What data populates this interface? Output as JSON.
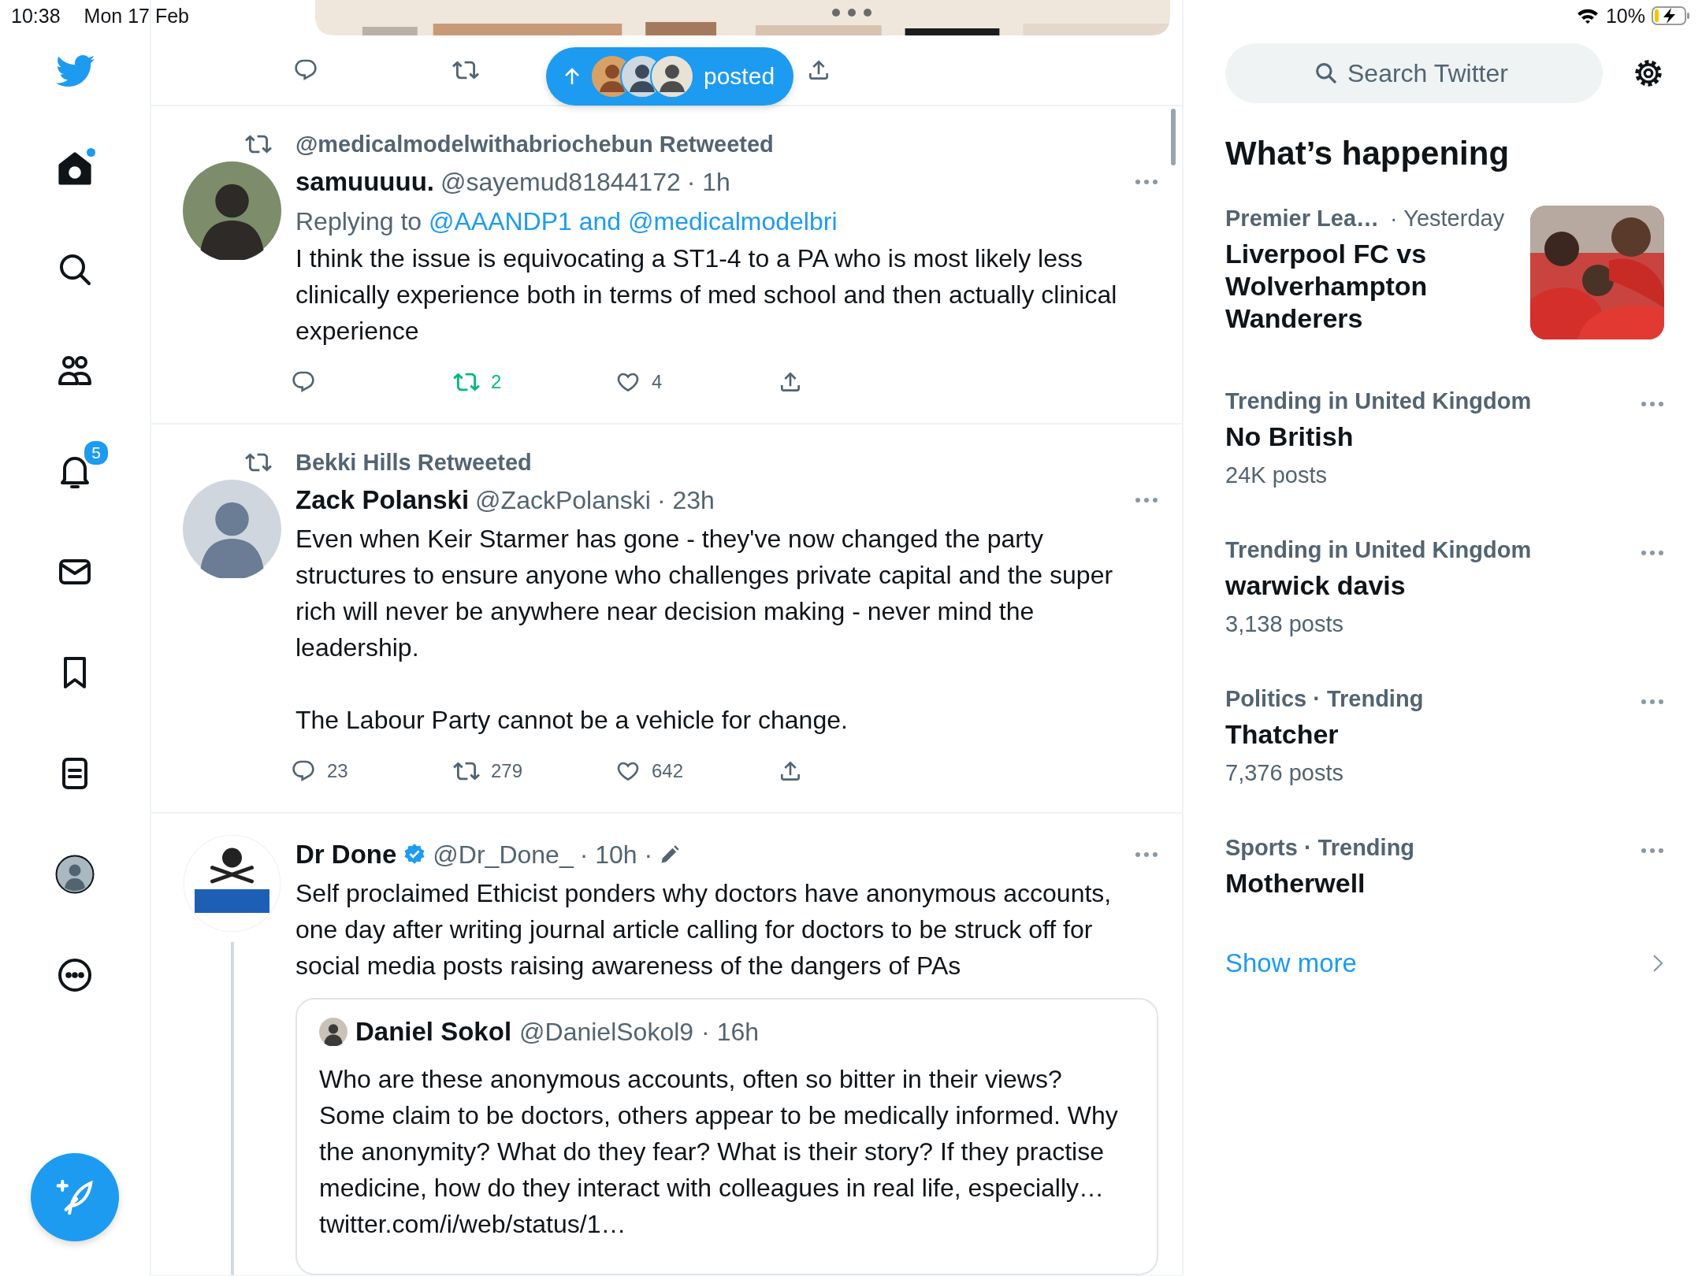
{
  "status_bar": {
    "time": "10:38",
    "date": "Mon 17 Feb",
    "battery": "10%",
    "charging": true
  },
  "sidebar": {
    "items": [
      {
        "kind": "home",
        "selected": true,
        "unread": true
      },
      {
        "kind": "explore",
        "selected": false,
        "unread": false
      },
      {
        "kind": "communities",
        "selected": false,
        "unread": false
      },
      {
        "kind": "notifications",
        "selected": false,
        "unread": false,
        "badge": "5"
      },
      {
        "kind": "messages",
        "selected": false,
        "unread": false
      },
      {
        "kind": "bookmarks",
        "selected": false,
        "unread": false
      },
      {
        "kind": "lists",
        "selected": false,
        "unread": false
      },
      {
        "kind": "profile",
        "selected": false,
        "unread": false
      },
      {
        "kind": "more",
        "selected": false,
        "unread": false
      }
    ]
  },
  "new_posts_pill": {
    "label": "posted"
  },
  "tweets": [
    {
      "retweeted_by": "@medicalmodelwithabriochebun Retweeted",
      "name": "samuuuuu.",
      "verified": false,
      "handle": "@sayemud81844172",
      "time": "· 1h",
      "edited": false,
      "thread": false,
      "replying": {
        "prefix": "Replying to",
        "users": "@AAANDP1 and @medicalmodelbri"
      },
      "paragraphs": [
        "I think the issue is equivocating a ST1-4 to a PA who is most likely less clinically experience both in terms of med school and then actually clinical experience"
      ],
      "actions": {
        "retweets": "2",
        "likes": "4",
        "retweeted": true,
        "liked": false
      }
    },
    {
      "retweeted_by": "Bekki Hills Retweeted",
      "name": "Zack Polanski",
      "verified": false,
      "handle": "@ZackPolanski",
      "time": "· 23h",
      "edited": false,
      "thread": false,
      "paragraphs": [
        "Even when Keir Starmer has gone - they've now changed the party structures to ensure anyone who challenges private capital and the super rich will never be anywhere near decision making - never mind the leadership.",
        "The Labour Party cannot be a vehicle for change."
      ],
      "actions": {
        "replies": "23",
        "retweets": "279",
        "likes": "642",
        "retweeted": false,
        "liked": false
      }
    },
    {
      "name": "Dr Done",
      "verified": true,
      "handle": "@Dr_Done_",
      "time": "· 10h ·",
      "edited": true,
      "thread": true,
      "paragraphs": [
        "Self proclaimed Ethicist ponders why doctors have anonymous accounts, one day after writing journal article calling for doctors to be struck off for social media posts raising awareness of the dangers of PAs"
      ],
      "quote": {
        "name": "Daniel Sokol",
        "handle": "@DanielSokol9",
        "time": "· 16h",
        "text": "Who are these anonymous accounts, often so bitter in their views? Some claim to be doctors, others appear to be medically informed. Why the anonymity? What do they fear? What is their story? If they practise medicine, how do they interact with colleagues in real life, especially… twitter.com/i/web/status/1…"
      }
    }
  ],
  "search": {
    "placeholder": "Search Twitter"
  },
  "trends_heading": "What’s happening",
  "trends": [
    {
      "kind": "event",
      "context": "Premier Lea…",
      "meta": "· Yesterday",
      "title": "Liverpool FC vs Wolverhampton Wanderers"
    },
    {
      "kind": "trend",
      "context": "Trending in United Kingdom",
      "title": "No British",
      "count": "24K posts"
    },
    {
      "kind": "trend",
      "context": "Trending in United Kingdom",
      "title": "warwick davis",
      "count": "3,138 posts"
    },
    {
      "kind": "trend",
      "context": "Politics · Trending",
      "title": "Thatcher",
      "count": "7,376 posts"
    },
    {
      "kind": "trend",
      "context": "Sports · Trending",
      "title": "Motherwell"
    }
  ],
  "show_more": "Show more"
}
